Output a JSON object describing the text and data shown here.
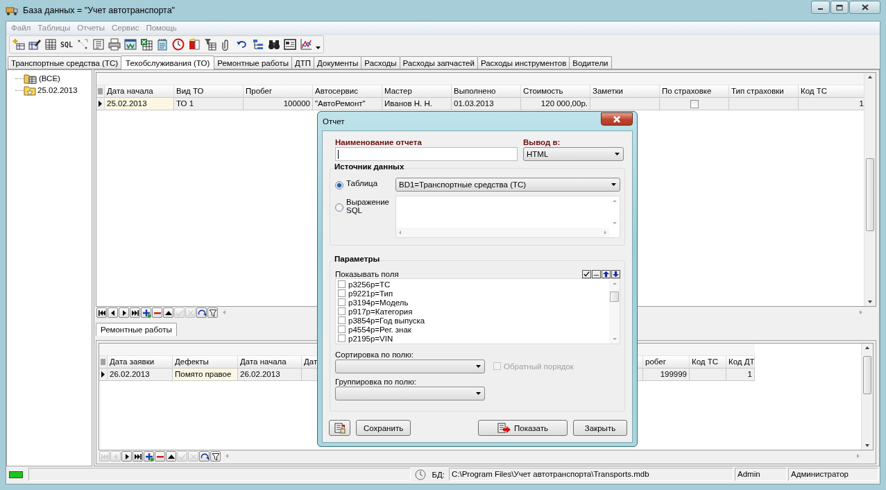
{
  "window": {
    "title": "База данных = \"Учет автотранспорта\""
  },
  "menu": [
    {
      "label": "Файл",
      "disabled": true
    },
    {
      "label": "Таблицы",
      "disabled": true
    },
    {
      "label": "Отчеты",
      "disabled": true
    },
    {
      "label": "Сервис",
      "disabled": true
    },
    {
      "label": "Помощь",
      "disabled": true
    }
  ],
  "toolbar": {
    "sql_label": "SQL"
  },
  "tabs": [
    {
      "label": "Транспортные средства (ТС)",
      "selected": false
    },
    {
      "label": "Техобслуживания (ТО)",
      "selected": true
    },
    {
      "label": "Ремонтные работы",
      "selected": false
    },
    {
      "label": "ДТП",
      "selected": false
    },
    {
      "label": "Документы",
      "selected": false
    },
    {
      "label": "Расходы",
      "selected": false
    },
    {
      "label": "Расходы запчастей",
      "selected": false
    },
    {
      "label": "Расходы инструментов",
      "selected": false
    },
    {
      "label": "Водители",
      "selected": false
    }
  ],
  "tree": [
    {
      "label": "(ВСЕ)",
      "kind": "all"
    },
    {
      "label": "25.02.2013",
      "kind": "date"
    }
  ],
  "maintenance_grid": {
    "columns": [
      {
        "label": "Дата начала",
        "numeric": false
      },
      {
        "label": "Вид ТО",
        "numeric": false
      },
      {
        "label": "Пробег",
        "numeric": true
      },
      {
        "label": "Автосервис",
        "numeric": false
      },
      {
        "label": "Мастер",
        "numeric": false
      },
      {
        "label": "Выполнено",
        "numeric": false
      },
      {
        "label": "Стоимость",
        "numeric": true
      },
      {
        "label": "Заметки"
      },
      {
        "label": "По страховке"
      },
      {
        "label": "Тип страховки"
      },
      {
        "label": "Код ТС",
        "numeric": true
      }
    ],
    "rows": [
      {
        "selected": true,
        "cells": [
          {
            "kind": "text",
            "text": "25.02.2013",
            "focused": true
          },
          {
            "kind": "text",
            "text": "ТО 1",
            "focused": false
          },
          {
            "kind": "text",
            "text": "100000",
            "focused": false
          },
          {
            "kind": "text",
            "text": "\"АвтоРемонт\"",
            "focused": false
          },
          {
            "kind": "text",
            "text": "Иванов Н. Н.",
            "focused": false
          },
          {
            "kind": "text",
            "text": "01.03.2013",
            "focused": false
          },
          {
            "kind": "text",
            "text": "120 000,00р.",
            "focused": false
          },
          {
            "kind": "text",
            "text": "",
            "focused": false
          },
          {
            "kind": "checkbox",
            "checked": false,
            "focused": false
          },
          {
            "kind": "text",
            "text": "",
            "focused": false
          },
          {
            "kind": "text",
            "text": "1",
            "focused": false
          }
        ]
      }
    ]
  },
  "maintenance_navigator": [
    {
      "kind": "first",
      "disabled": false
    },
    {
      "kind": "prior",
      "disabled": false
    },
    {
      "kind": "next",
      "disabled": false
    },
    {
      "kind": "last",
      "disabled": false
    },
    {
      "kind": "insert",
      "disabled": false
    },
    {
      "kind": "delete",
      "disabled": false
    },
    {
      "kind": "edit",
      "disabled": false
    },
    {
      "kind": "post",
      "disabled": true
    },
    {
      "kind": "cancel",
      "disabled": true
    },
    {
      "kind": "refresh",
      "disabled": false
    },
    {
      "kind": "filter",
      "disabled": false
    }
  ],
  "repair_panel": {
    "tab": "Ремонтные работы",
    "grid": {
      "columns": [
        {
          "label": "Дата заявки",
          "numeric": false
        },
        {
          "label": "Дефекты",
          "numeric": false
        },
        {
          "label": "Дата начала",
          "numeric": false
        },
        {
          "label": "Дат"
        },
        {
          "label": "робег",
          "numeric": true
        },
        {
          "label": "Код ТС"
        },
        {
          "label": "Код ДТ",
          "numeric": true
        }
      ],
      "rows": [
        {
          "selected": true,
          "cells": [
            {
              "kind": "text",
              "text": "26.02.2013",
              "focused": false
            },
            {
              "kind": "text",
              "text": "Помято правое",
              "focused": true
            },
            {
              "kind": "text",
              "text": "26.02.2013",
              "focused": false
            },
            {
              "kind": "text",
              "text": "",
              "focused": false
            },
            {
              "kind": "text",
              "text": "199999",
              "focused": false
            },
            {
              "kind": "text",
              "text": "",
              "focused": false
            },
            {
              "kind": "text",
              "text": "1",
              "focused": false
            }
          ]
        }
      ]
    },
    "navigator": [
      {
        "kind": "first",
        "disabled": true
      },
      {
        "kind": "prior",
        "disabled": true
      },
      {
        "kind": "next",
        "disabled": false
      },
      {
        "kind": "last",
        "disabled": false
      },
      {
        "kind": "insert",
        "disabled": false
      },
      {
        "kind": "delete",
        "disabled": false
      },
      {
        "kind": "edit",
        "disabled": false
      },
      {
        "kind": "post",
        "disabled": true
      },
      {
        "kind": "cancel",
        "disabled": true
      },
      {
        "kind": "refresh",
        "disabled": false
      },
      {
        "kind": "filter",
        "disabled": false
      }
    ]
  },
  "report_dialog": {
    "title": "Отчет",
    "name_label": "Наименование отчета",
    "output_label": "Вывод в:",
    "output_value": "HTML",
    "source_heading": "Источник данных",
    "sources": [
      {
        "label": "Таблица",
        "selected": true,
        "kind": "table",
        "value": "BD1=Транспортные средства (ТС)"
      },
      {
        "label": "Выражение SQL",
        "selected": false,
        "kind": "sql"
      }
    ],
    "params_heading": "Параметры",
    "fields_label": "Показывать поля",
    "fields": [
      {
        "label": "p3256p=ТС",
        "checked": false
      },
      {
        "label": "p9221p=Тип",
        "checked": false
      },
      {
        "label": "p3194p=Модель",
        "checked": false
      },
      {
        "label": "p917p=Категория",
        "checked": false
      },
      {
        "label": "p3854p=Год выпуска",
        "checked": false
      },
      {
        "label": "p4554p=Рег. знак",
        "checked": false
      },
      {
        "label": "p2195p=VIN",
        "checked": false
      }
    ],
    "sort_label": "Сортировка по полю:",
    "reverse": {
      "label": "Обратный порядок",
      "checked": false,
      "disabled": true
    },
    "group_label": "Группировка по полю:",
    "buttons": [
      {
        "kind": "icon"
      },
      {
        "kind": "text",
        "label": "Сохранить"
      },
      {
        "kind": "primary",
        "label": "Показать"
      },
      {
        "kind": "text",
        "label": "Закрыть"
      }
    ]
  },
  "status_bar": {
    "db_label": "БД:",
    "path": "C:\\Program Files\\Учет автотранспорта\\Transports.mdb",
    "user": "Admin",
    "role": "Администратор"
  }
}
